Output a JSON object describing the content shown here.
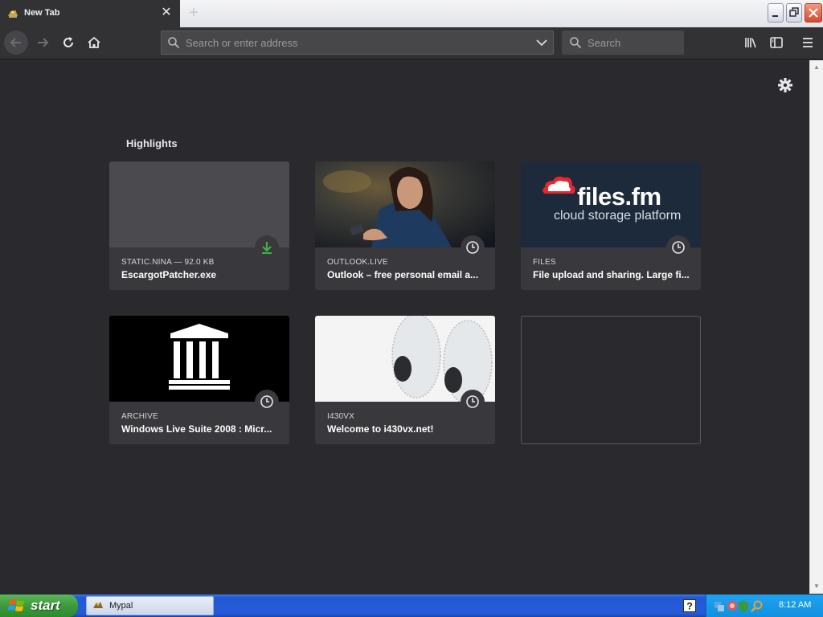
{
  "browser": {
    "tab": {
      "title": "New Tab",
      "close_icon": "close-icon"
    },
    "window_buttons": [
      "minimize",
      "restore",
      "close"
    ],
    "nav": {
      "url_placeholder": "Search or enter address",
      "search_placeholder": "Search"
    }
  },
  "page": {
    "highlights_title": "Highlights",
    "cards": [
      {
        "host": "STATIC.NINA — 92.0 KB",
        "title": "EscargotPatcher.exe",
        "badge_icon": "download-icon",
        "badge_color": "#3fb33f"
      },
      {
        "host": "OUTLOOK.LIVE",
        "title": "Outlook – free personal email a...",
        "badge_icon": "clock-icon"
      },
      {
        "host": "FILES",
        "title": "File upload and sharing. Large fi...",
        "badge_icon": "clock-icon",
        "logo_name": "files.fm",
        "logo_tagline": "cloud storage platform"
      },
      {
        "host": "ARCHIVE",
        "title": "Windows Live Suite 2008 : Micr...",
        "badge_icon": "clock-icon"
      },
      {
        "host": "I430VX",
        "title": "Welcome to i430vx.net!",
        "badge_icon": "clock-icon"
      }
    ]
  },
  "taskbar": {
    "start_label": "start",
    "task_label": "Mypal",
    "clock": "8:12 AM"
  },
  "colors": {
    "page_bg": "#2a2a2e",
    "toolbar_bg": "#323234",
    "card_bg": "#38383d",
    "download_green": "#3fb33f",
    "taskbar_blue": "#245ad7",
    "start_green": "#3c9a3c"
  }
}
